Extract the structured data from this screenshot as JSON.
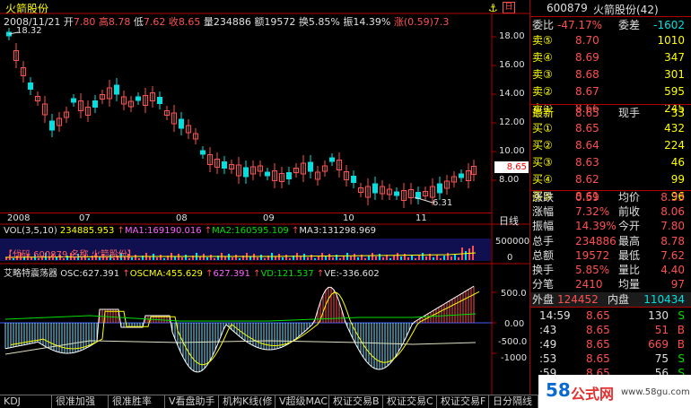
{
  "stock": {
    "name": "火箭股份",
    "code": "600879",
    "title_code": "600879",
    "title_name": "火箭股份(42)"
  },
  "info_bar": {
    "date": "2008/11/21",
    "open_label": "开",
    "open": "7.80",
    "high_label": "高",
    "high": "8.78",
    "low_label": "低",
    "low": "7.62",
    "close_label": "收",
    "close": "8.65",
    "vol_label": "量",
    "vol": "234886",
    "amt_label": "额",
    "amt": "19572",
    "turn_label": "换",
    "turn": "5.85%",
    "amp_label": "振",
    "amp": "14.39%",
    "chg_label": "涨",
    "chg": "(0.59)7.3"
  },
  "price_axis": [
    "18.00",
    "16.00",
    "14.00",
    "12.00",
    "10.00",
    "8.00"
  ],
  "price_marks": {
    "high": "18.32",
    "low": "6.31",
    "last": "8.65"
  },
  "months": [
    "2008",
    "07",
    "08",
    "09",
    "10",
    "11"
  ],
  "period": "日线",
  "vol": {
    "title": "VOL(3,5,10)",
    "v": "234885.953",
    "ma1": "MA1:169190.016",
    "ma2": "MA2:160595.109",
    "ma3": "MA3:131298.969",
    "ticks": [
      "500000",
      "0"
    ]
  },
  "code_band": "【代码 600879 名称 火箭股份】",
  "osc": {
    "title": "艾略特震荡器",
    "osc": "OSC:627.391",
    "oscma": "OSCMA:455.629",
    "v3": "627.391",
    "vd": "VD:121.537",
    "ve": "VE:-336.602",
    "ticks": [
      "500.0",
      "0.00",
      "-500.0",
      "-1000"
    ]
  },
  "quote": {
    "weibi_label": "委比",
    "weibi": "-47.17%",
    "weicha_label": "委差",
    "weicha": "-1602",
    "sells": [
      {
        "label": "卖⑤",
        "price": "8.70",
        "vol": "1010"
      },
      {
        "label": "卖④",
        "price": "8.69",
        "vol": "347"
      },
      {
        "label": "卖③",
        "price": "8.68",
        "vol": "301"
      },
      {
        "label": "卖②",
        "price": "8.67",
        "vol": "595"
      },
      {
        "label": "卖①",
        "price": "8.66",
        "vol": "245"
      }
    ],
    "last_label": "最新",
    "last": "8.65",
    "now_label": "现手",
    "now": "33",
    "buys": [
      {
        "label": "买①",
        "price": "8.65",
        "vol": "432"
      },
      {
        "label": "买②",
        "price": "8.64",
        "vol": "224"
      },
      {
        "label": "买③",
        "price": "8.63",
        "vol": "46"
      },
      {
        "label": "买④",
        "price": "8.62",
        "vol": "99"
      },
      {
        "label": "买⑤",
        "price": "8.61",
        "vol": "96"
      }
    ],
    "stats": [
      {
        "l1": "涨跌",
        "v1": "0.59",
        "l2": "均价",
        "v2": "8.33"
      },
      {
        "l1": "涨幅",
        "v1": "7.32%",
        "l2": "前收",
        "v2": "8.06"
      },
      {
        "l1": "振幅",
        "v1": "14.39%",
        "l2": "今开",
        "v2": "7.80"
      },
      {
        "l1": "总手",
        "v1": "234886",
        "l2": "最高",
        "v2": "8.78"
      },
      {
        "l1": "总额",
        "v1": "19572",
        "l2": "最低",
        "v2": "7.62"
      },
      {
        "l1": "换手",
        "v1": "5.85%",
        "l2": "量比",
        "v2": "4.40"
      },
      {
        "l1": "分笔",
        "v1": "2410",
        "l2": "均量",
        "v2": "97"
      }
    ],
    "outer_label": "外盘",
    "outer": "124452",
    "inner_label": "内盘",
    "inner": "110434"
  },
  "ticks": [
    {
      "time": "14:59",
      "price": "8.65",
      "vol": "130",
      "side": "S"
    },
    {
      "time": ":43",
      "price": "8.65",
      "vol": "51",
      "side": "B"
    },
    {
      "time": ":49",
      "price": "8.65",
      "vol": "669",
      "side": "B"
    },
    {
      "time": ":53",
      "price": "8.65",
      "vol": "75",
      "side": "S"
    },
    {
      "time": ":59",
      "price": "8.65",
      "vol": "56",
      "side": "S"
    },
    {
      "time": "15",
      "price": "",
      "vol": "",
      "side": ""
    }
  ],
  "tabs": [
    "KDJ",
    "很准加强",
    "很准胜率",
    "V看盘助手",
    "机构K线(修",
    "V超级MACD",
    "权证交易B",
    "权证交易C",
    "权证交易F",
    "日分隔线"
  ],
  "brand": {
    "num": "58",
    "text": "公式网",
    "url": "www.58gu.com"
  },
  "colors": {
    "up": "#ff5050",
    "down": "#00e0e0",
    "bg": "#000000",
    "axis": "#b00000"
  }
}
